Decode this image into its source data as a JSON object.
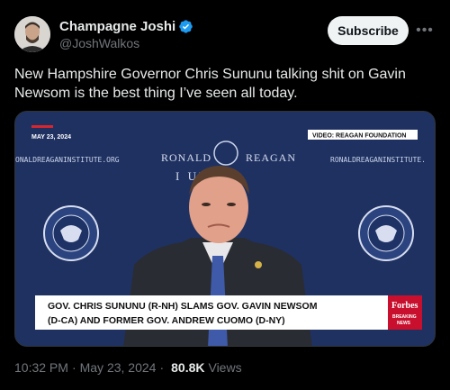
{
  "author": {
    "display_name": "Champagne Joshi",
    "handle": "@JoshWalkos",
    "verified": true,
    "avatar_icon": "person-avatar"
  },
  "actions": {
    "subscribe_label": "Subscribe",
    "more_icon": "more-icon"
  },
  "tweet": {
    "text": "New Hampshire Governor Chris Sununu talking shit on Gavin Newsom is the best thing I’ve seen all today."
  },
  "video": {
    "date_tag": "MAY 23, 2024",
    "source_tag": "VIDEO: REAGAN FOUNDATION",
    "backdrop_left": "ONALDREAGANINSTITUTE.ORG",
    "backdrop_right": "RONALDREAGANINSTITUTE.",
    "institute_line1_left": "RONALD",
    "institute_line1_right": "REAGAN",
    "institute_line2": "I      UTE",
    "chyron_line1": "GOV. CHRIS SUNUNU (R-NH) SLAMS GOV. GAVIN NEWSOM",
    "chyron_line2": "(D-CA) AND FORMER GOV. ANDREW CUOMO (D-NY)",
    "brand": "Forbes",
    "brand_sub1": "BREAKING",
    "brand_sub2": "NEWS",
    "colors": {
      "backdrop": "#20325e",
      "chyron": "#ffffff",
      "brand_bg": "#c8102e",
      "accent_bar": "#d7262e"
    }
  },
  "meta": {
    "time": "10:32 PM",
    "separator": "·",
    "date": "May 23, 2024",
    "views_count": "80.8K",
    "views_label": "Views"
  }
}
